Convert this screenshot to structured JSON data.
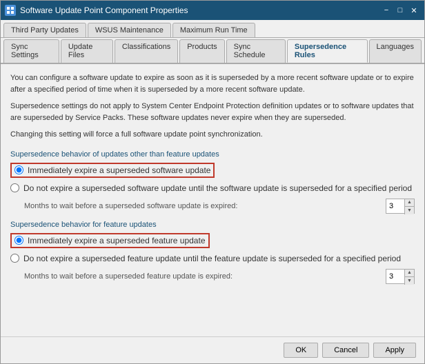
{
  "window": {
    "title": "Software Update Point Component Properties",
    "icon": "settings-icon"
  },
  "tabs_row1": [
    {
      "label": "Third Party Updates",
      "active": false
    },
    {
      "label": "WSUS Maintenance",
      "active": false
    },
    {
      "label": "Maximum Run Time",
      "active": false
    }
  ],
  "tabs_row2": [
    {
      "label": "Sync Settings",
      "active": false
    },
    {
      "label": "Update Files",
      "active": false
    },
    {
      "label": "Classifications",
      "active": false
    },
    {
      "label": "Products",
      "active": false
    },
    {
      "label": "Sync Schedule",
      "active": false
    },
    {
      "label": "Supersedence Rules",
      "active": true
    },
    {
      "label": "Languages",
      "active": false
    }
  ],
  "info": {
    "paragraph1": "You can configure a software update to expire as soon as it is superseded by a more recent software update or to expire after a specified period of time when it is superseded by a more recent software update.",
    "paragraph2": "Supersedence settings do not apply to System Center Endpoint Protection definition updates or to software updates that are superseded by Service Packs. These software updates never expire when they are superseded.",
    "paragraph3": "Changing this setting will force a full software update point synchronization."
  },
  "section1": {
    "label": "Supersedence behavior of updates other than feature updates",
    "option1": "Immediately expire a superseded software update",
    "option1_selected": true,
    "option2": "Do not expire a superseded software update until the software update is superseded for a specified period",
    "option2_selected": false,
    "months_label": "Months to wait before a superseded software update is expired:",
    "months_value": "3"
  },
  "section2": {
    "label": "Supersedence behavior for feature updates",
    "option1": "Immediately expire a superseded feature update",
    "option1_selected": true,
    "option2": "Do not expire a superseded feature update until the feature update is superseded for a specified period",
    "option2_selected": false,
    "months_label": "Months to wait before a superseded feature update is expired:",
    "months_value": "3"
  },
  "footer": {
    "ok": "OK",
    "cancel": "Cancel",
    "apply": "Apply"
  }
}
